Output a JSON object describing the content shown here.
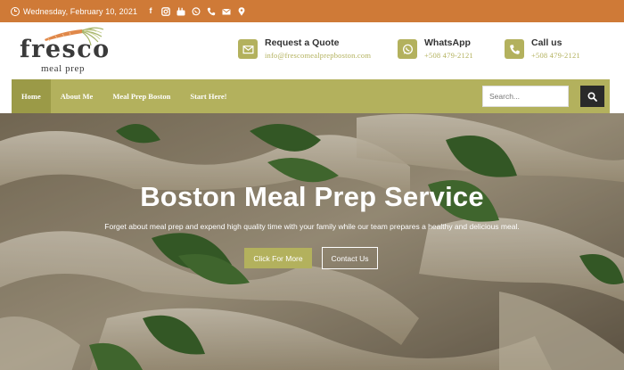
{
  "topbar": {
    "date": "Wednesday, February 10, 2021",
    "background": "#cf7a37",
    "social_icons": [
      "facebook-icon",
      "instagram-icon",
      "youtube-icon",
      "whatsapp-icon",
      "phone-icon",
      "mail-icon",
      "location-icon"
    ]
  },
  "logo": {
    "brand": "fresco",
    "tagline": "meal prep"
  },
  "contacts": [
    {
      "title": "Request a Quote",
      "subtitle": "info@frescomealprepboston.com",
      "icon": "envelope-icon"
    },
    {
      "title": "WhatsApp",
      "subtitle": "+508 479-2121",
      "icon": "whatsapp-icon"
    },
    {
      "title": "Call us",
      "subtitle": "+508 479-2121",
      "icon": "phone-icon"
    }
  ],
  "nav": {
    "items": [
      "Home",
      "About Me",
      "Meal Prep Boston",
      "Start Here!"
    ],
    "active": "Home",
    "search_placeholder": "Search..."
  },
  "hero": {
    "title": "Boston Meal Prep Service",
    "subtitle": "Forget about meal prep and expend high quality time with your family while our team prepares a healthy and delicious meal.",
    "primary_button": "Click For More",
    "secondary_button": "Contact Us"
  },
  "colors": {
    "accent": "#b3b15d",
    "accent_dark": "#9b9a47",
    "topbar": "#cf7a37",
    "search_button": "#2a2a2a"
  }
}
